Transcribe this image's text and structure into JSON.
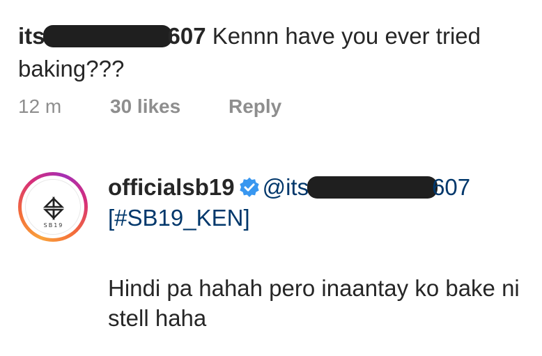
{
  "comment": {
    "username_start": "its",
    "username_end": "607",
    "text": " Kennn have you ever tried baking???",
    "time": "12 m",
    "likes": "30 likes",
    "reply": "Reply"
  },
  "reply": {
    "username": "officialsb19",
    "mention_start": "@its",
    "mention_end": "607",
    "hashtag": "[#SB19_KEN]",
    "body": "Hindi pa hahah pero inaantay ko bake ni stell haha",
    "avatar_text": "SB19"
  },
  "colors": {
    "text": "#262626",
    "meta": "#8e8e8e",
    "link": "#00376b",
    "verified": "#3897f0"
  }
}
